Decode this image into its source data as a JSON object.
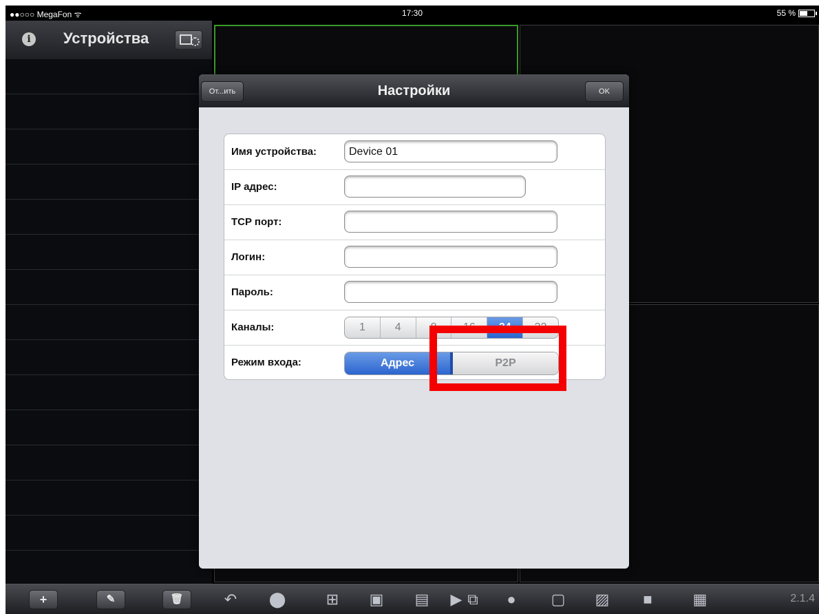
{
  "statusbar": {
    "carrier": "●●○○○ MegaFon ᯤ",
    "time": "17:30",
    "battery": "55 %"
  },
  "sidebar": {
    "title": "Устройства",
    "info_icon": "info-icon",
    "settings_icon": "device-settings-icon"
  },
  "dialog": {
    "title": "Настройки",
    "cancel_label": "От...ить",
    "ok_label": "OK",
    "fields": {
      "device_name": {
        "label": "Имя устройства:",
        "value": "Device 01"
      },
      "ip": {
        "label": "IP адрес:",
        "value": ""
      },
      "tcp_port": {
        "label": "TCP порт:",
        "value": ""
      },
      "login": {
        "label": "Логин:",
        "value": ""
      },
      "password": {
        "label": "Пароль:",
        "value": ""
      }
    },
    "channels": {
      "label": "Каналы:",
      "options": [
        "1",
        "4",
        "8",
        "16",
        "24",
        "32"
      ],
      "selected": "24"
    },
    "login_mode": {
      "label": "Режим входа:",
      "options": [
        "Адрес",
        "P2P"
      ],
      "selected": "Адрес"
    }
  },
  "toolbar": {
    "left_buttons": [
      "add-icon",
      "edit-icon",
      "trash-icon"
    ],
    "icons": [
      "back-arrow-icon",
      "ptz-icon",
      "layout-icon",
      "close-video-icon",
      "record-icon",
      "play-icon",
      "playback-icon",
      "light-icon",
      "location-icon",
      "fullscreen-icon",
      "snapshot-icon",
      "camera-icon",
      "camera-settings-icon"
    ],
    "version": "2.1.4"
  },
  "highlight_color": "#f40000",
  "accent_color": "#2b65cf"
}
